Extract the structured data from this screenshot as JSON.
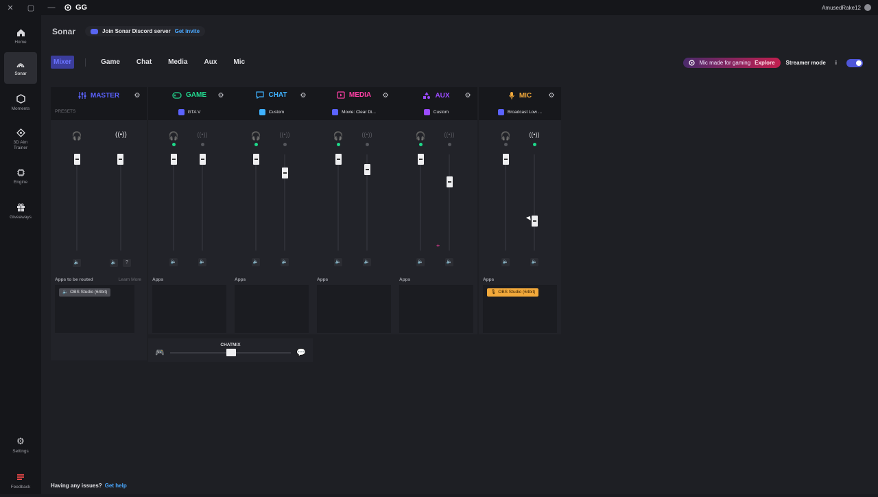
{
  "titlebar": {
    "close": "✕",
    "maximize": "▢",
    "minimize": "—",
    "app_name": "GG",
    "username": "AmusedRake12"
  },
  "sidebar": {
    "items": [
      {
        "label": "Home",
        "icon": "home-icon"
      },
      {
        "label": "Sonar",
        "icon": "sonar-icon"
      },
      {
        "label": "Moments",
        "icon": "moments-icon"
      },
      {
        "label": "3D Aim Trainer",
        "icon": "aim-trainer-icon"
      },
      {
        "label": "Engine",
        "icon": "engine-icon"
      },
      {
        "label": "Giveaways",
        "icon": "giveaways-icon"
      },
      {
        "label": "Settings",
        "icon": "settings-icon"
      },
      {
        "label": "Feedback",
        "icon": "feedback-icon"
      }
    ]
  },
  "header": {
    "title": "Sonar",
    "discord_text": "Join Sonar Discord server",
    "discord_link": "Get invite"
  },
  "tabs": [
    "Mixer",
    "Game",
    "Chat",
    "Media",
    "Aux",
    "Mic"
  ],
  "right_tools": {
    "mic_promo": "Mic made for gaming",
    "explore": "Explore",
    "streamer_mode": "Streamer mode",
    "info": "i",
    "streamer_mode_on": true
  },
  "channels": {
    "master": {
      "name": "MASTER",
      "color": "#5b63ff",
      "presets_label": "PRESETS",
      "apps_label": "Apps to be routed",
      "learn_more": "Learn More",
      "app": "OBS Studio (64bit)"
    },
    "game": {
      "name": "GAME",
      "color": "#22d98f",
      "preset": "GTA V",
      "apps_label": "Apps"
    },
    "chat": {
      "name": "CHAT",
      "color": "#3fb2ff",
      "preset": "Custom",
      "apps_label": "Apps"
    },
    "media": {
      "name": "MEDIA",
      "color": "#ff3fa5",
      "preset": "Movie: Clear Di...",
      "apps_label": "Apps"
    },
    "aux": {
      "name": "AUX",
      "color": "#9b4bff",
      "preset": "Custom",
      "apps_label": "Apps"
    },
    "mic": {
      "name": "MIC",
      "color": "#f2a93b",
      "preset": "Broadcast Low ...",
      "apps_label": "Apps",
      "app": "OBS Studio (64bit)"
    }
  },
  "chatmix": {
    "label": "CHATMIX"
  },
  "footer": {
    "text": "Having any issues?",
    "link": "Get help"
  }
}
